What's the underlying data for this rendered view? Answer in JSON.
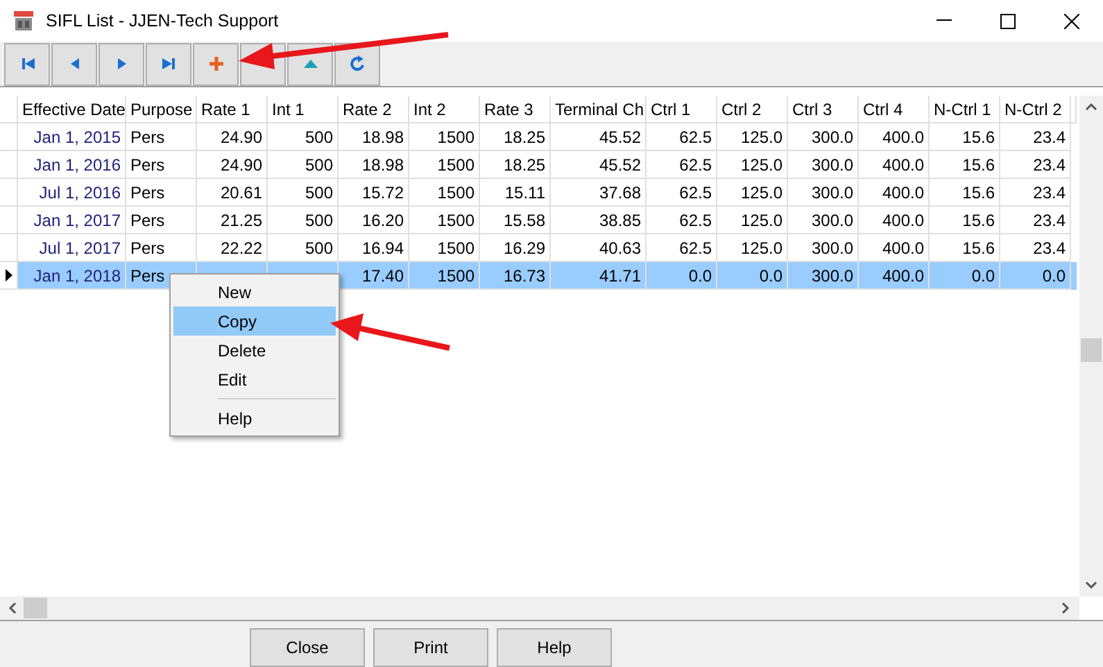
{
  "window": {
    "title": "SIFL List - JJEN-Tech Support"
  },
  "toolbar": [
    {
      "kind": "first"
    },
    {
      "kind": "prev"
    },
    {
      "kind": "next"
    },
    {
      "kind": "last"
    },
    {
      "kind": "add"
    },
    {
      "kind": "blank"
    },
    {
      "kind": "up"
    },
    {
      "kind": "refresh"
    }
  ],
  "table": {
    "columns": [
      "Effective Date",
      "Purpose",
      "Rate 1",
      "Int 1",
      "Rate 2",
      "Int 2",
      "Rate 3",
      "Terminal Ch",
      "Ctrl 1",
      "Ctrl 2",
      "Ctrl 3",
      "Ctrl 4",
      "N-Ctrl 1",
      "N-Ctrl 2"
    ],
    "rows": [
      {
        "selected": false,
        "cells": [
          "Jan 1, 2015",
          "Pers",
          "24.90",
          "500",
          "18.98",
          "1500",
          "18.25",
          "45.52",
          "62.5",
          "125.0",
          "300.0",
          "400.0",
          "15.6",
          "23.4"
        ]
      },
      {
        "selected": false,
        "cells": [
          "Jan 1, 2016",
          "Pers",
          "24.90",
          "500",
          "18.98",
          "1500",
          "18.25",
          "45.52",
          "62.5",
          "125.0",
          "300.0",
          "400.0",
          "15.6",
          "23.4"
        ]
      },
      {
        "selected": false,
        "cells": [
          "Jul 1, 2016",
          "Pers",
          "20.61",
          "500",
          "15.72",
          "1500",
          "15.11",
          "37.68",
          "62.5",
          "125.0",
          "300.0",
          "400.0",
          "15.6",
          "23.4"
        ]
      },
      {
        "selected": false,
        "cells": [
          "Jan 1, 2017",
          "Pers",
          "21.25",
          "500",
          "16.20",
          "1500",
          "15.58",
          "38.85",
          "62.5",
          "125.0",
          "300.0",
          "400.0",
          "15.6",
          "23.4"
        ]
      },
      {
        "selected": false,
        "cells": [
          "Jul 1, 2017",
          "Pers",
          "22.22",
          "500",
          "16.94",
          "1500",
          "16.29",
          "40.63",
          "62.5",
          "125.0",
          "300.0",
          "400.0",
          "15.6",
          "23.4"
        ]
      },
      {
        "selected": true,
        "cells": [
          "Jan 1, 2018",
          "Pers",
          null,
          null,
          "17.40",
          "1500",
          "16.73",
          "41.71",
          "0.0",
          "0.0",
          "300.0",
          "400.0",
          "0.0",
          "0.0"
        ]
      }
    ]
  },
  "context_menu": [
    {
      "kind": "item",
      "label": "New",
      "selected": false
    },
    {
      "kind": "item",
      "label": "Copy",
      "selected": true
    },
    {
      "kind": "item",
      "label": "Delete",
      "selected": false
    },
    {
      "kind": "item",
      "label": "Edit",
      "selected": false
    },
    {
      "kind": "separator"
    },
    {
      "kind": "item",
      "label": "Help",
      "selected": false
    }
  ],
  "buttons": [
    "Close",
    "Print",
    "Help"
  ]
}
